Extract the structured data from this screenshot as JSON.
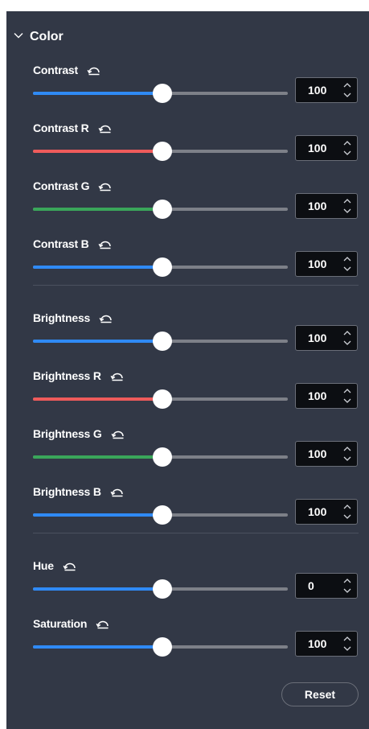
{
  "section": {
    "title": "Color",
    "expanded": true,
    "chevron_icon": "chevron-down-icon"
  },
  "colors": {
    "panel_background": "#323846",
    "blue": "#2f8af5",
    "red": "#ef5b5b",
    "green": "#3aa65a",
    "track": "#7d8088"
  },
  "groups": [
    {
      "controls": [
        {
          "id": "contrast",
          "label": "Contrast",
          "value": "100",
          "color": "blue",
          "fraction": 0.5
        },
        {
          "id": "contrast-r",
          "label": "Contrast R",
          "value": "100",
          "color": "red",
          "fraction": 0.5
        },
        {
          "id": "contrast-g",
          "label": "Contrast G",
          "value": "100",
          "color": "green",
          "fraction": 0.5
        },
        {
          "id": "contrast-b",
          "label": "Contrast B",
          "value": "100",
          "color": "blue",
          "fraction": 0.5
        }
      ]
    },
    {
      "controls": [
        {
          "id": "brightness",
          "label": "Brightness",
          "value": "100",
          "color": "blue",
          "fraction": 0.5
        },
        {
          "id": "brightness-r",
          "label": "Brightness R",
          "value": "100",
          "color": "red",
          "fraction": 0.5
        },
        {
          "id": "brightness-g",
          "label": "Brightness G",
          "value": "100",
          "color": "green",
          "fraction": 0.5
        },
        {
          "id": "brightness-b",
          "label": "Brightness B",
          "value": "100",
          "color": "blue",
          "fraction": 0.5
        }
      ]
    },
    {
      "controls": [
        {
          "id": "hue",
          "label": "Hue",
          "value": "0",
          "color": "blue",
          "fraction": 0.5
        },
        {
          "id": "saturation",
          "label": "Saturation",
          "value": "100",
          "color": "blue",
          "fraction": 0.5
        }
      ]
    }
  ],
  "reset_button": {
    "label": "Reset"
  }
}
